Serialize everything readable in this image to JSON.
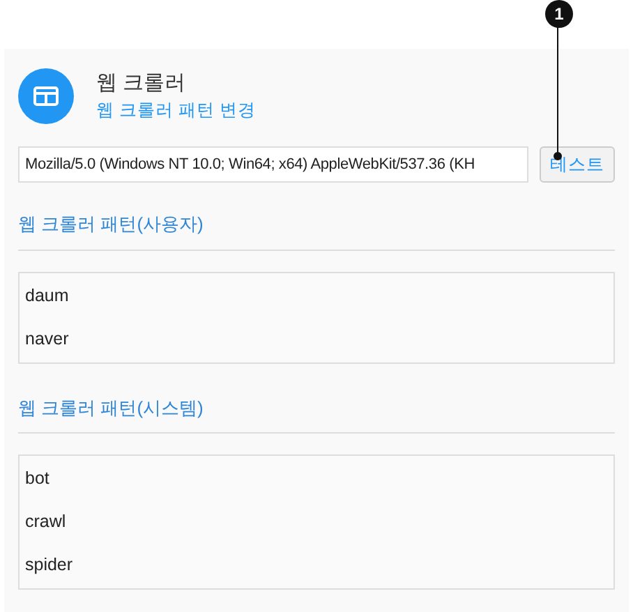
{
  "callout": {
    "label": "1"
  },
  "header": {
    "title": "웹 크롤러",
    "subtitle": "웹 크롤러 패턴 변경"
  },
  "test": {
    "value": "Mozilla/5.0 (Windows NT 10.0; Win64; x64) AppleWebKit/537.36 (KH",
    "button": "테스트"
  },
  "sections": [
    {
      "title": "웹 크롤러 패턴(사용자)",
      "items": [
        "daum",
        "naver"
      ]
    },
    {
      "title": "웹 크롤러 패턴(시스템)",
      "items": [
        "bot",
        "crawl",
        "spider"
      ]
    }
  ]
}
